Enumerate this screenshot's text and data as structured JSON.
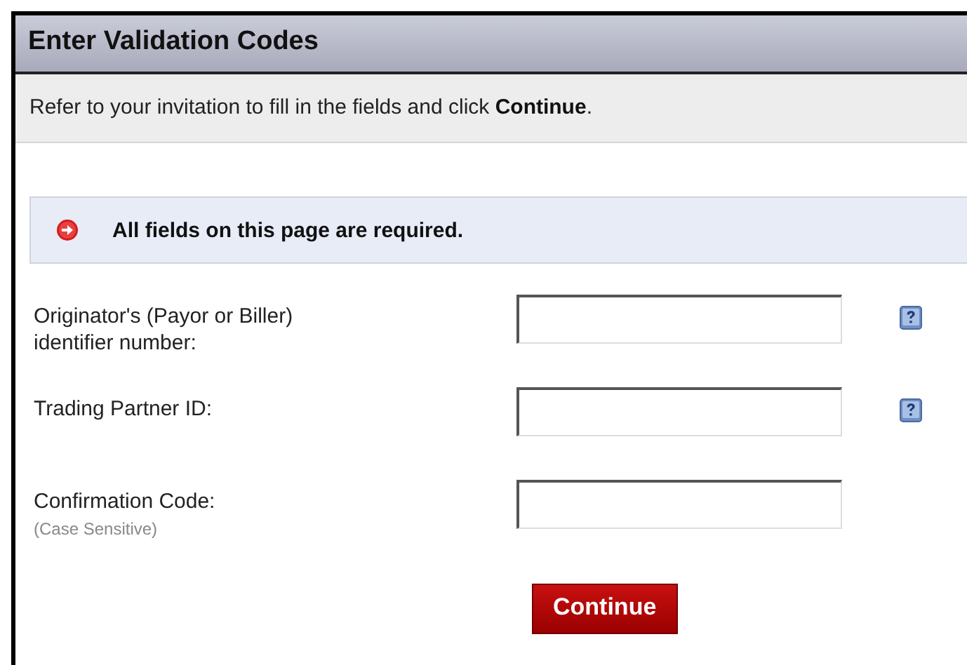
{
  "title": "Enter Validation Codes",
  "intro": "Refer to your invitation to fill in the fields and click **Continue**.",
  "notice": "All fields on this page are required.",
  "fields": [
    {
      "label": "Originator's (Payor or Biller) identifier number:",
      "help": true
    },
    {
      "label": "Trading Partner ID:",
      "help": true
    },
    {
      "label": "Confirmation Code:",
      "hint": "(Case Sensitive)",
      "help": false
    }
  ],
  "button": "Continue"
}
